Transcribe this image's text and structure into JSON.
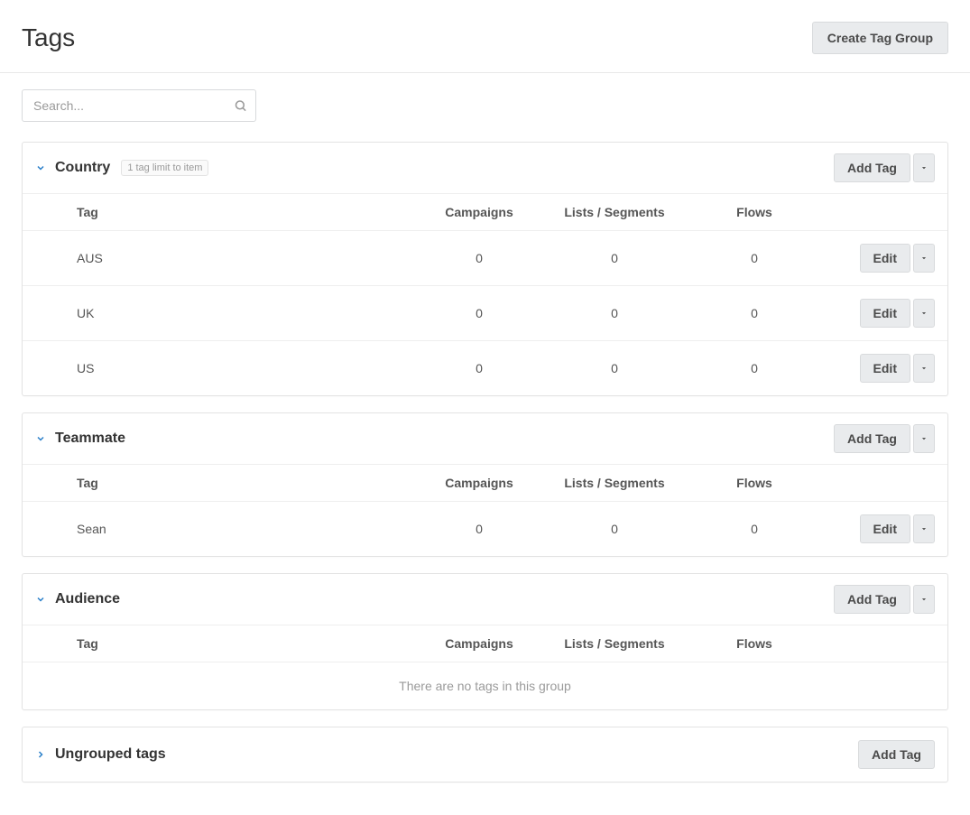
{
  "header": {
    "title": "Tags",
    "create_group_label": "Create Tag Group"
  },
  "search": {
    "placeholder": "Search..."
  },
  "columns": {
    "tag": "Tag",
    "campaigns": "Campaigns",
    "lists": "Lists / Segments",
    "flows": "Flows"
  },
  "buttons": {
    "add_tag": "Add Tag",
    "edit": "Edit"
  },
  "empty_message": "There are no tags in this group",
  "groups": [
    {
      "name": "Country",
      "limit_badge": "1 tag limit to item",
      "expanded": true,
      "has_dropdown": true,
      "rows": [
        {
          "tag": "AUS",
          "campaigns": "0",
          "lists": "0",
          "flows": "0"
        },
        {
          "tag": "UK",
          "campaigns": "0",
          "lists": "0",
          "flows": "0"
        },
        {
          "tag": "US",
          "campaigns": "0",
          "lists": "0",
          "flows": "0"
        }
      ]
    },
    {
      "name": "Teammate",
      "expanded": true,
      "has_dropdown": true,
      "rows": [
        {
          "tag": "Sean",
          "campaigns": "0",
          "lists": "0",
          "flows": "0"
        }
      ]
    },
    {
      "name": "Audience",
      "expanded": true,
      "has_dropdown": true,
      "rows": []
    },
    {
      "name": "Ungrouped tags",
      "expanded": false,
      "has_dropdown": false,
      "rows": []
    }
  ]
}
